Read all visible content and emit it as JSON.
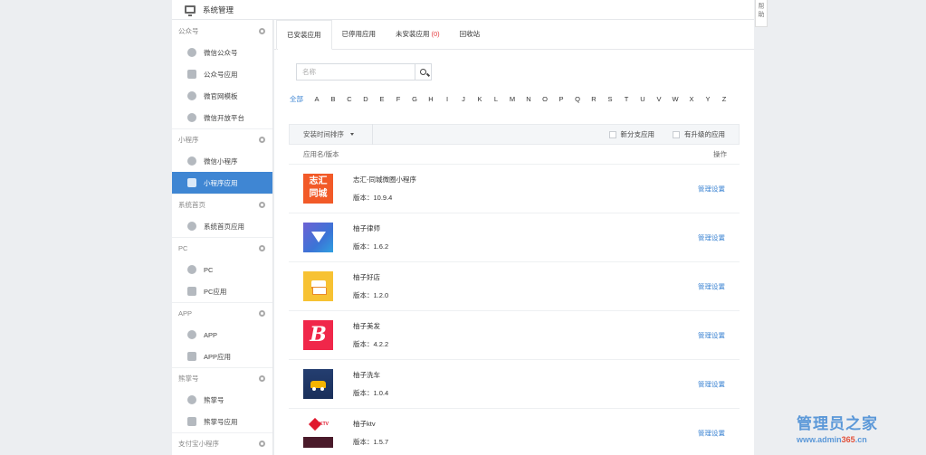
{
  "header": {
    "title": "系统管理"
  },
  "help_tab": {
    "label": "帮 助"
  },
  "sidebar": {
    "groups": [
      {
        "label": "公众号",
        "items": [
          {
            "label": "微信公众号",
            "icon": "wechat-icon"
          },
          {
            "label": "公众号应用",
            "icon": "app-icon"
          },
          {
            "label": "微官网模板",
            "icon": "template-icon"
          },
          {
            "label": "微信开放平台",
            "icon": "open-platform-icon"
          }
        ]
      },
      {
        "label": "小程序",
        "items": [
          {
            "label": "微信小程序",
            "icon": "miniprogram-icon"
          },
          {
            "label": "小程序应用",
            "icon": "app-icon",
            "active": true
          }
        ]
      },
      {
        "label": "系统首页",
        "items": [
          {
            "label": "系统首页应用",
            "icon": "home-app-icon"
          }
        ]
      },
      {
        "label": "PC",
        "items": [
          {
            "label": "PC",
            "icon": "pc-icon"
          },
          {
            "label": "PC应用",
            "icon": "app-icon"
          }
        ]
      },
      {
        "label": "APP",
        "items": [
          {
            "label": "APP",
            "icon": "app-platform-icon"
          },
          {
            "label": "APP应用",
            "icon": "app-icon"
          }
        ]
      },
      {
        "label": "熊掌号",
        "items": [
          {
            "label": "熊掌号",
            "icon": "paw-icon"
          },
          {
            "label": "熊掌号应用",
            "icon": "app-icon"
          }
        ]
      },
      {
        "label": "支付宝小程序",
        "items": []
      }
    ]
  },
  "tabs": [
    {
      "label": "已安装应用",
      "active": true
    },
    {
      "label": "已停用应用"
    },
    {
      "label": "未安装应用",
      "badge": "(0)"
    },
    {
      "label": "回收站"
    }
  ],
  "search": {
    "placeholder": "名称"
  },
  "alpha": {
    "all_label": "全部",
    "letters": [
      "A",
      "B",
      "C",
      "D",
      "E",
      "F",
      "G",
      "H",
      "I",
      "J",
      "K",
      "L",
      "M",
      "N",
      "O",
      "P",
      "Q",
      "R",
      "S",
      "T",
      "U",
      "V",
      "W",
      "X",
      "Y",
      "Z"
    ]
  },
  "filter": {
    "sort_label": "安装时间排序",
    "check_branch": "新分支应用",
    "check_upgrade": "有升级的应用"
  },
  "table": {
    "col_name": "应用名/版本",
    "col_action": "操作",
    "action_label": "管理设置",
    "rows": [
      {
        "name": "志汇-同城微圈小程序",
        "version": "版本：10.9.4",
        "icon_text": [
          "志汇",
          "同城"
        ]
      },
      {
        "name": "柚子律师",
        "version": "版本：1.6.2"
      },
      {
        "name": "柚子好店",
        "version": "版本：1.2.0"
      },
      {
        "name": "柚子美发",
        "version": "版本：4.2.2",
        "icon_text": "B"
      },
      {
        "name": "柚子洗车",
        "version": "版本：1.0.4"
      },
      {
        "name": "柚子ktv",
        "version": "版本：1.5.7",
        "icon_text": "KTV"
      }
    ]
  },
  "watermark": {
    "title": "管理员之家",
    "url_pre": "www.admin",
    "url_num": "365",
    "url_post": ".cn"
  }
}
